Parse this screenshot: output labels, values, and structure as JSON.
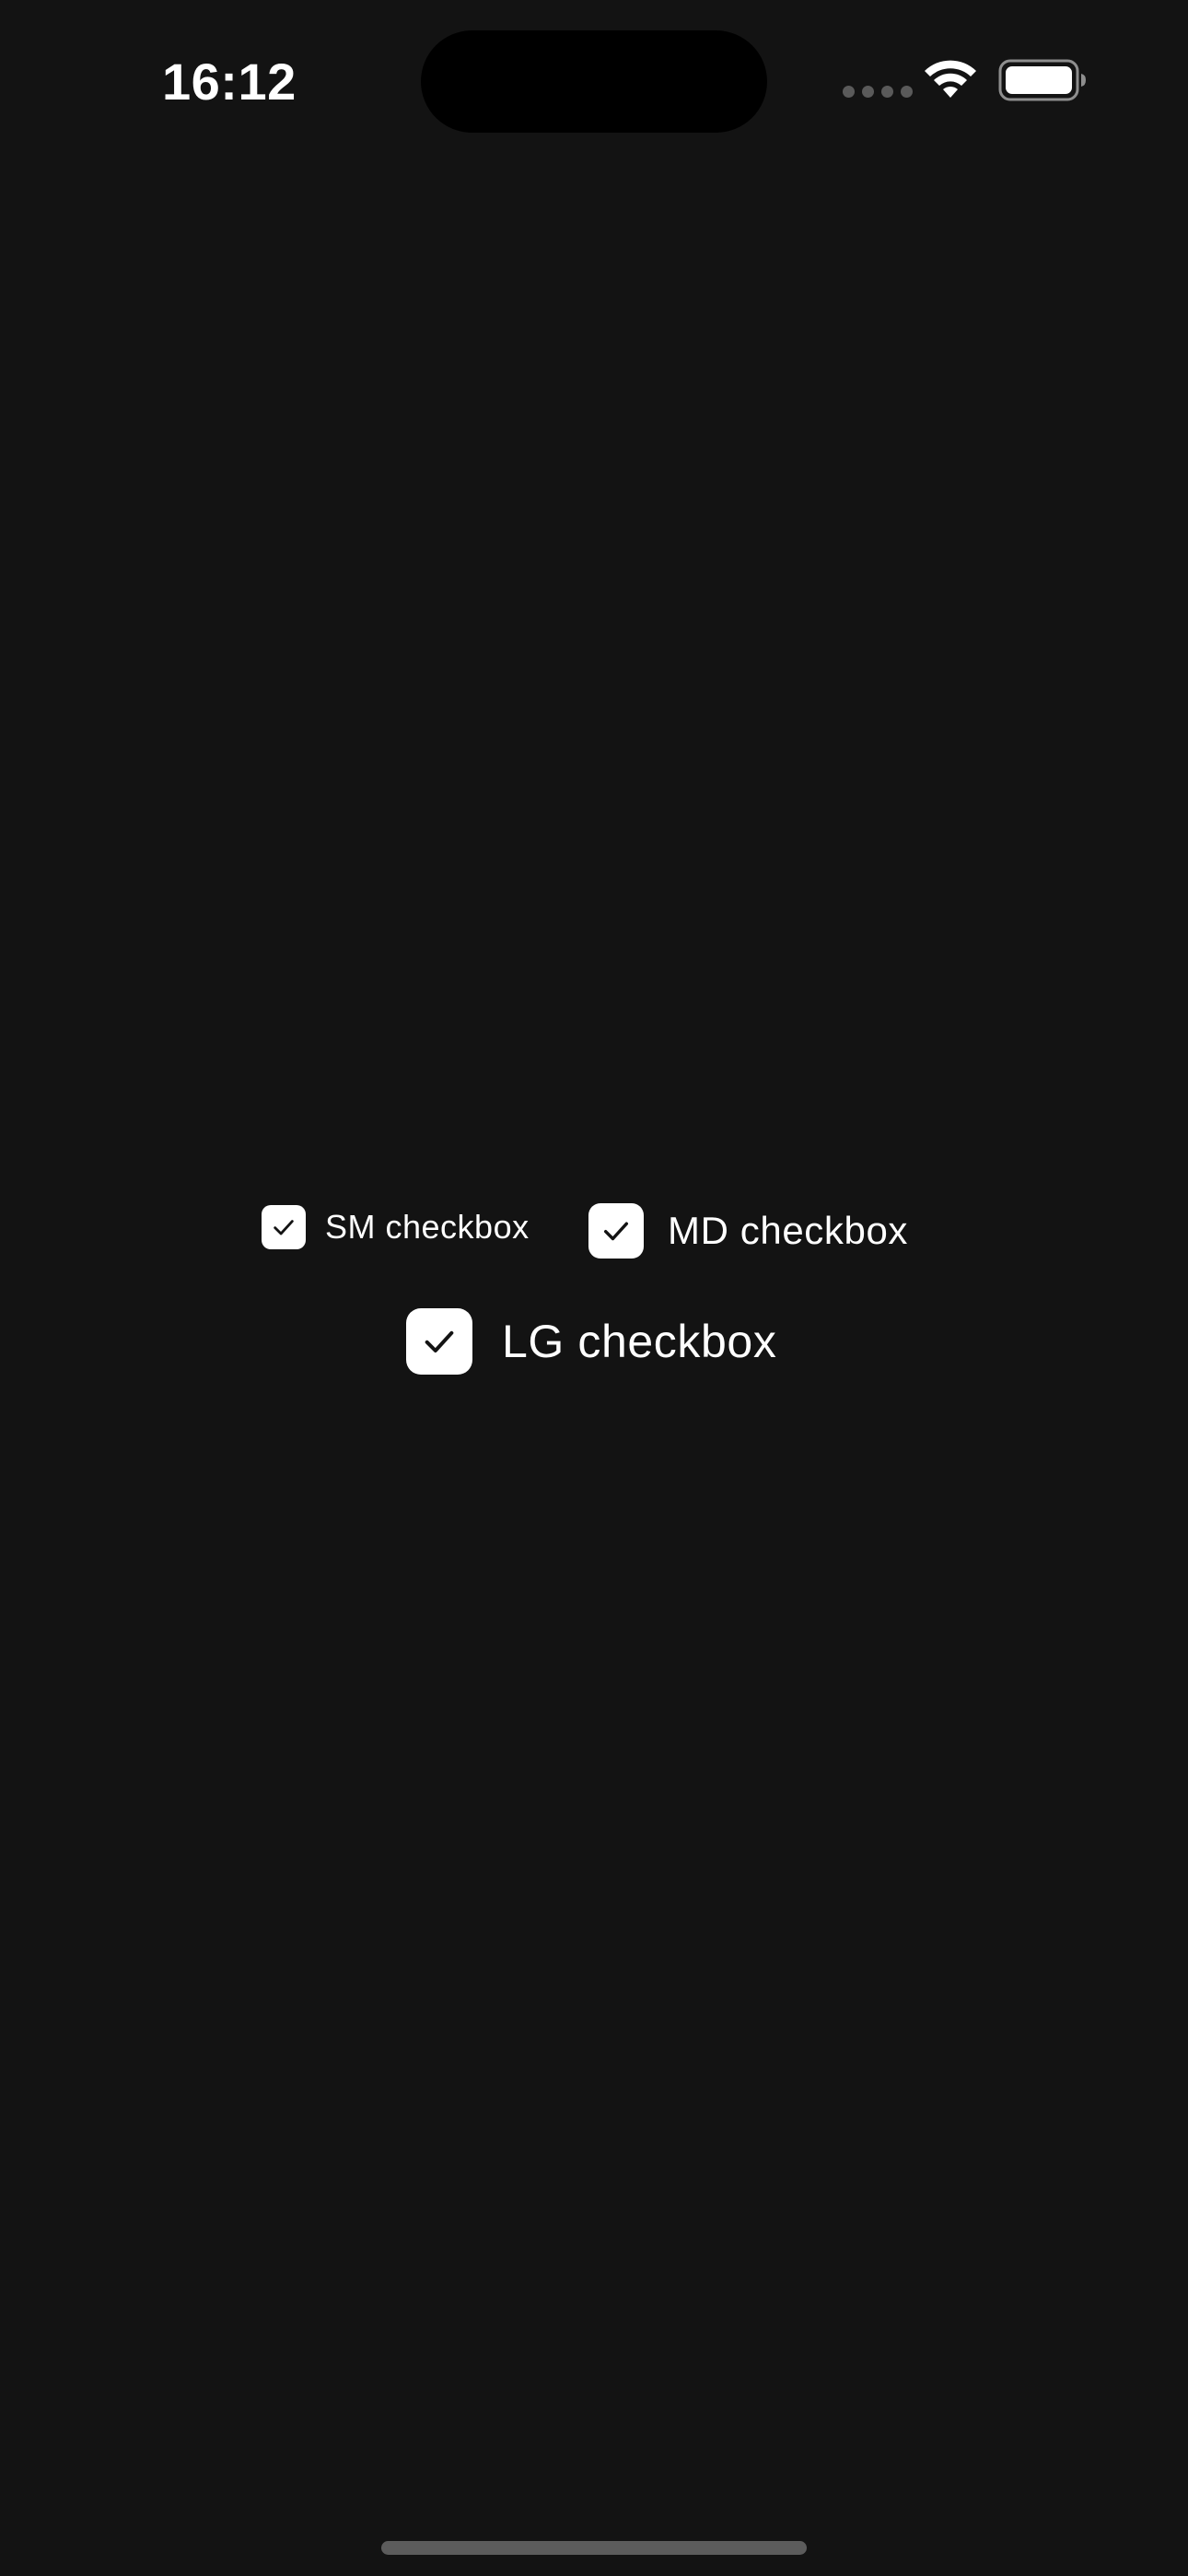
{
  "status_bar": {
    "time": "16:12",
    "icons": [
      "signal-dots-icon",
      "wifi-icon",
      "battery-icon"
    ]
  },
  "checkboxes": [
    {
      "size": "sm",
      "label": "SM checkbox",
      "checked": true,
      "icon": "checkmark-icon"
    },
    {
      "size": "md",
      "label": "MD checkbox",
      "checked": true,
      "icon": "checkmark-icon"
    },
    {
      "size": "lg",
      "label": "LG checkbox",
      "checked": true,
      "icon": "checkmark-icon"
    }
  ],
  "colors": {
    "background": "#131313",
    "checkbox_fill": "#ffffff",
    "checkmark": "#131313",
    "text": "#ffffff",
    "home_indicator": "#5c5c5c"
  }
}
